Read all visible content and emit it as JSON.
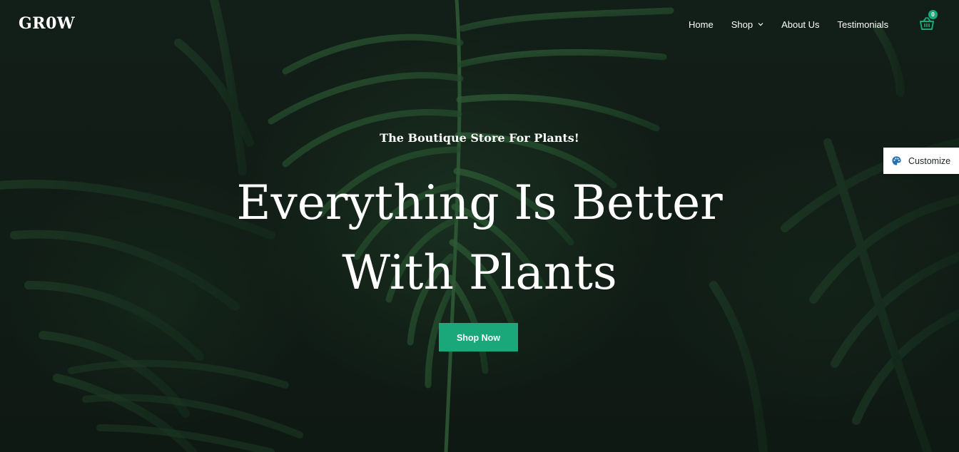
{
  "header": {
    "logo_text": "GR0W",
    "nav": [
      {
        "label": "Home"
      },
      {
        "label": "Shop",
        "has_dropdown": true
      },
      {
        "label": "About Us"
      },
      {
        "label": "Testimonials"
      }
    ],
    "cart": {
      "icon": "basket-icon",
      "count": "0"
    }
  },
  "hero": {
    "tagline": "The Boutique Store For Plants!",
    "headline": "Everything Is Better With Plants",
    "button_label": "Shop Now"
  },
  "customize": {
    "icon": "palette-icon",
    "label": "Customize"
  },
  "colors": {
    "accent": "#1aa87a",
    "background": "#14201a",
    "text": "#ffffff"
  }
}
